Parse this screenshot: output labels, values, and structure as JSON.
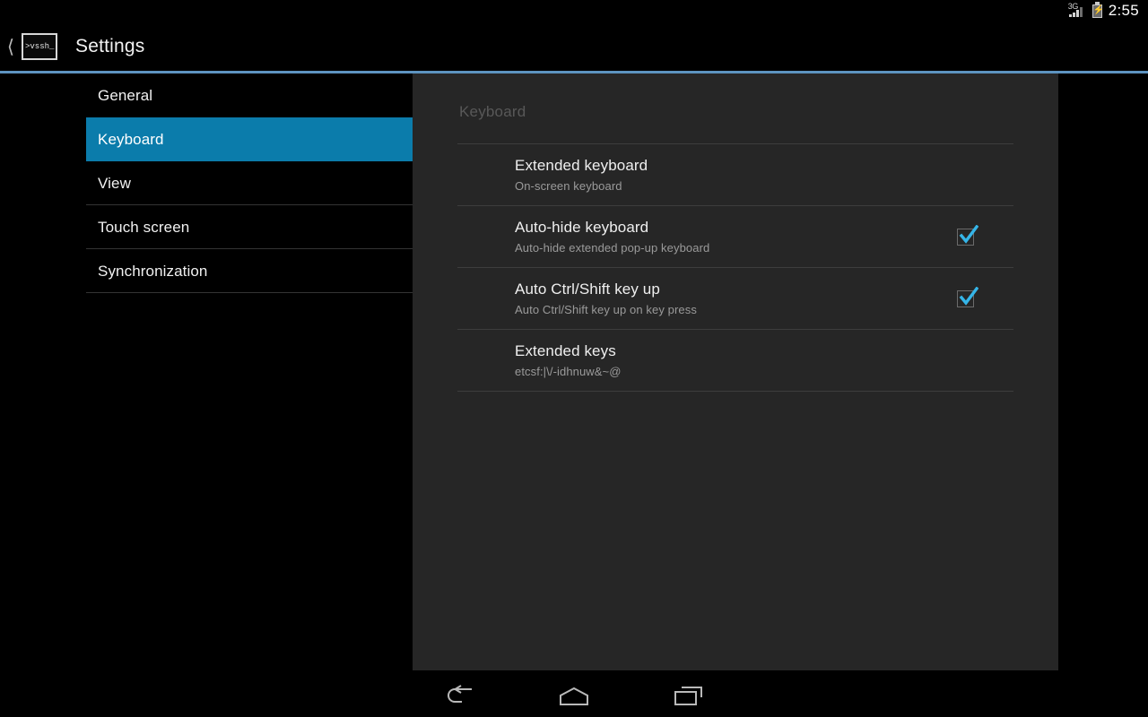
{
  "statusbar": {
    "network_label": "3G",
    "signal_icon": "signal-bars-icon",
    "battery_icon": "battery-charging-icon",
    "clock": "2:55"
  },
  "actionbar": {
    "back_icon": "back-chevron-icon",
    "app_icon_text": ">vssh_",
    "title": "Settings"
  },
  "sidebar": {
    "items": [
      {
        "label": "General",
        "selected": false
      },
      {
        "label": "Keyboard",
        "selected": true
      },
      {
        "label": "View",
        "selected": false
      },
      {
        "label": "Touch screen",
        "selected": false
      },
      {
        "label": "Synchronization",
        "selected": false
      }
    ]
  },
  "panel": {
    "header": "Keyboard",
    "preferences": [
      {
        "title": "Extended keyboard",
        "summary": "On-screen keyboard",
        "has_checkbox": false,
        "checked": false
      },
      {
        "title": "Auto-hide keyboard",
        "summary": "Auto-hide extended pop-up keyboard",
        "has_checkbox": true,
        "checked": true
      },
      {
        "title": "Auto Ctrl/Shift key up",
        "summary": "Auto Ctrl/Shift key up on key press",
        "has_checkbox": true,
        "checked": true
      },
      {
        "title": "Extended keys",
        "summary": "etcsf:|\\/-idhnuw&~@",
        "has_checkbox": false,
        "checked": false
      }
    ]
  },
  "navbar": {
    "back_icon": "back-arrow-icon",
    "home_icon": "home-icon",
    "recents_icon": "recent-apps-icon"
  },
  "colors": {
    "accent": "#0b7cab",
    "checkbox_check": "#35b5e8",
    "underline": "#5d93c0",
    "panel_bg": "#262626"
  }
}
